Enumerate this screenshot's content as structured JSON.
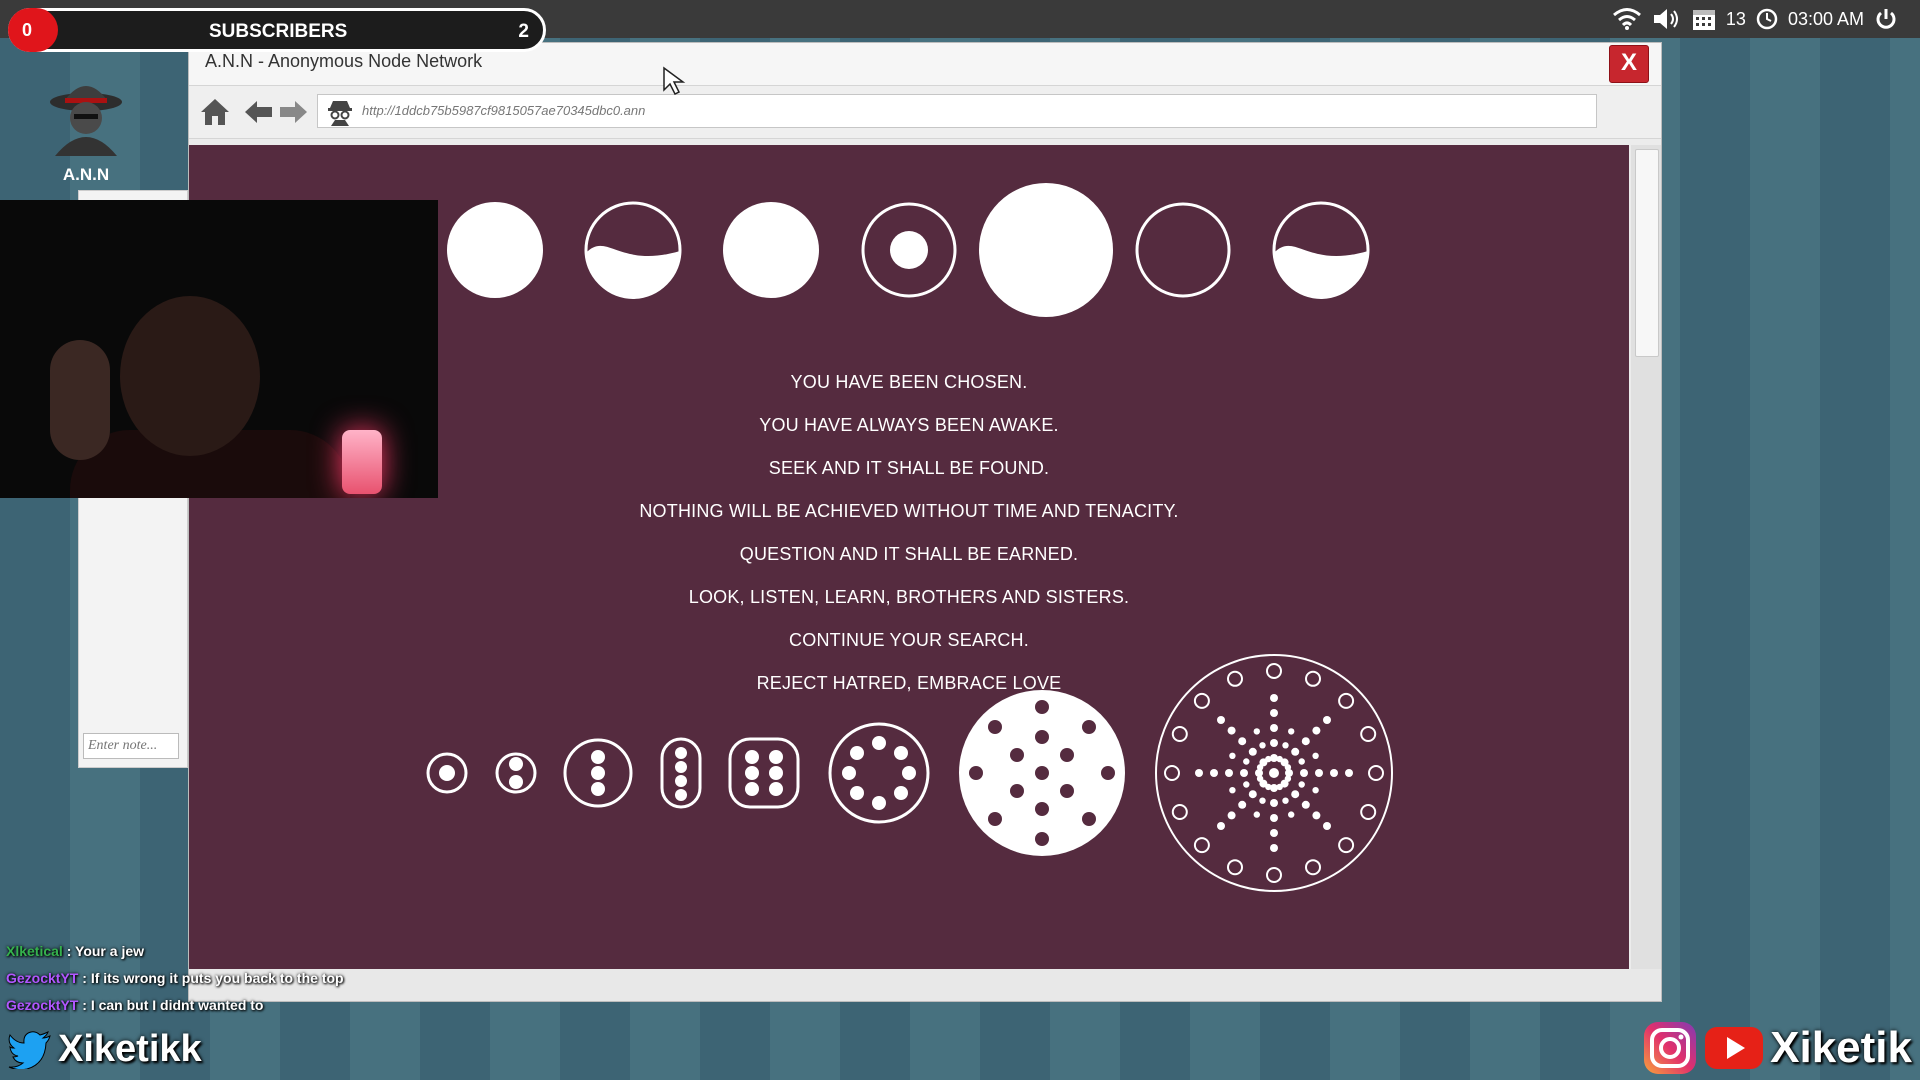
{
  "overlay": {
    "subscribers": {
      "count_left": "0",
      "label": "SUBSCRIBERS",
      "count_right": "2"
    },
    "twitter_handle": "Xiketikk",
    "youtube_handle": "Xiketik",
    "chat": [
      {
        "user": "Xlketical",
        "message": "Your a jew"
      },
      {
        "user": "GezocktYT",
        "message": "If its wrong it puts you back to the top"
      },
      {
        "user": "GezocktYT",
        "message": "I can but I didnt wanted to"
      }
    ]
  },
  "system_tray": {
    "icons": [
      "wifi-icon",
      "volume-icon",
      "calendar-icon",
      "clock-icon",
      "power-icon"
    ],
    "date": "13",
    "time": "03:00 AM"
  },
  "desktop": {
    "app_label": "A.N.N",
    "notes_placeholder": "Enter note..."
  },
  "browser": {
    "title": "A.N.N - Anonymous Node Network",
    "close_label": "X",
    "url": "http://1ddcb75b5987cf9815057ae70345dbc0.ann",
    "page": {
      "messages": [
        "YOU HAVE BEEN CHOSEN.",
        "YOU HAVE ALWAYS BEEN AWAKE.",
        "SEEK AND IT SHALL BE FOUND.",
        "NOTHING WILL BE ACHIEVED WITHOUT TIME AND TENACITY.",
        "QUESTION AND IT SHALL BE EARNED.",
        "LOOK, LISTEN, LEARN, BROTHERS AND SISTERS.",
        "CONTINUE YOUR SEARCH.",
        "REJECT HATRED, EMBRACE LOVE"
      ]
    }
  },
  "colors": {
    "page_bg": "#552b3f",
    "close_red": "#c7262e",
    "sub_red": "#e0151b"
  }
}
